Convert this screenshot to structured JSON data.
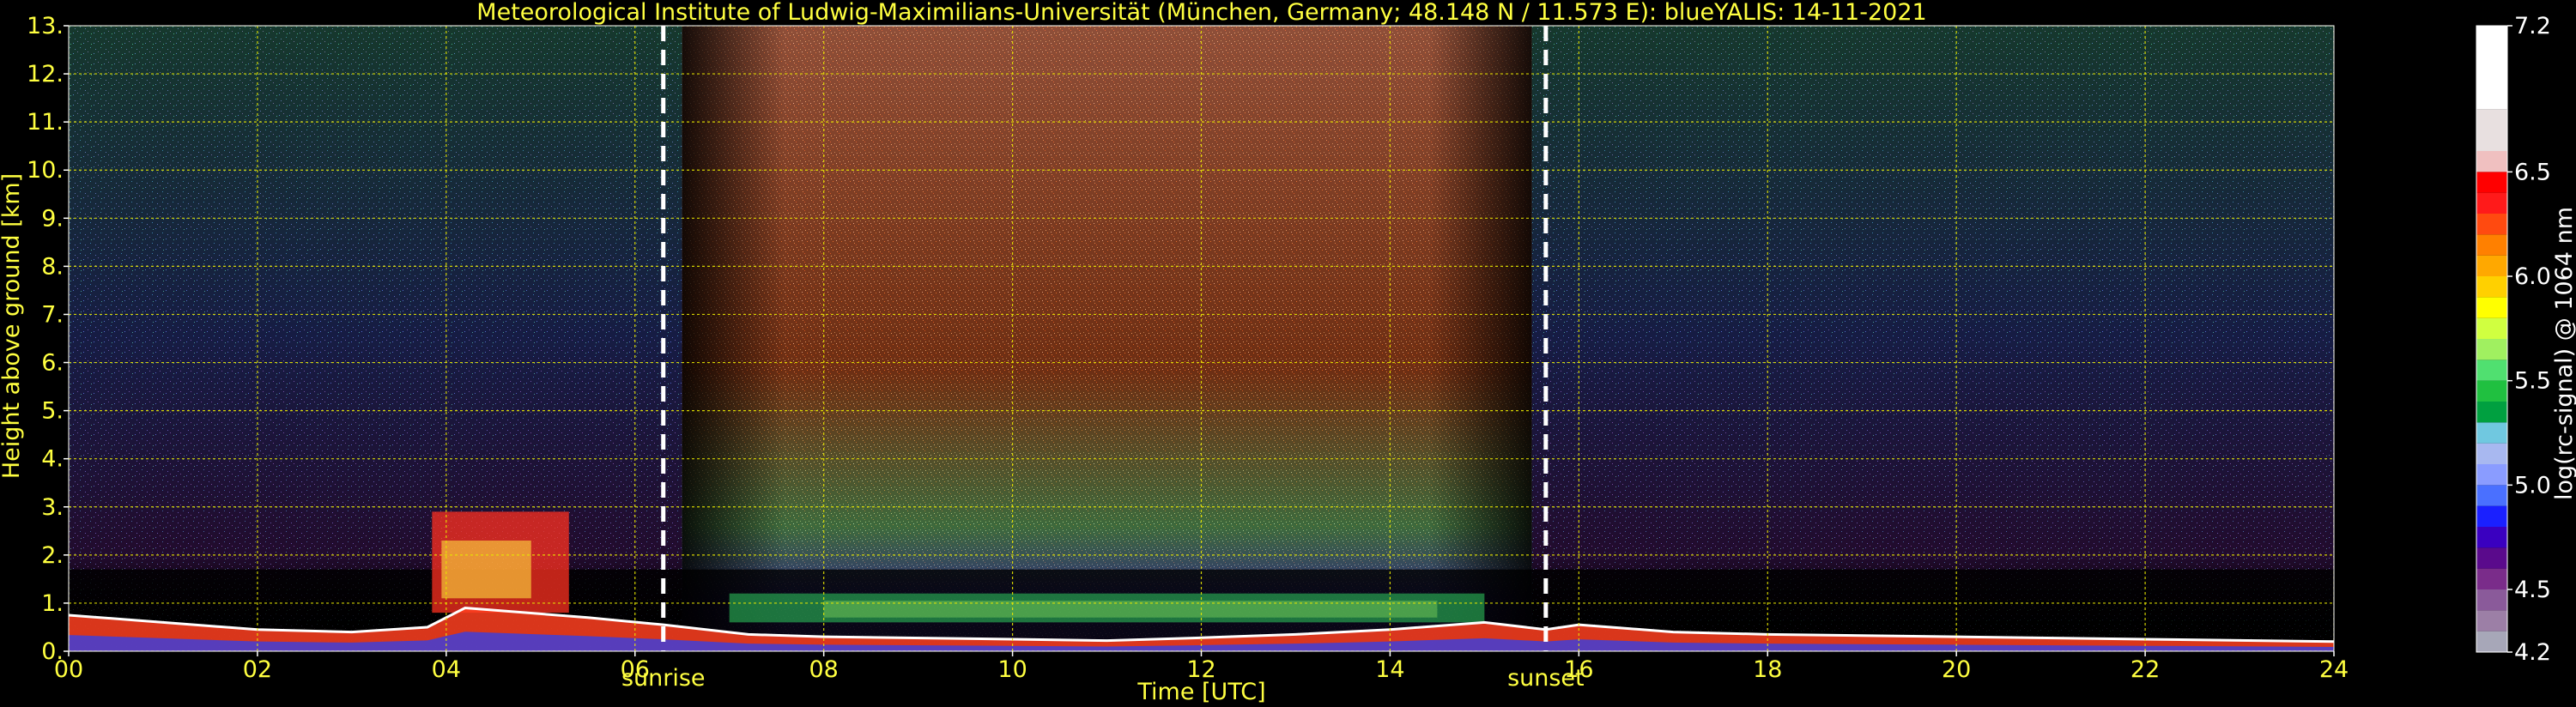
{
  "colors": {
    "background": "#000000",
    "text_yellow": "#ffff40",
    "text_white": "#ffffff",
    "grid": "#e8e800",
    "marker_line": "#ffffff"
  },
  "chart_data": {
    "type": "heatmap",
    "title": "Meteorological Institute of Ludwig-Maximilians-Universität (München, Germany; 48.148 N / 11.573 E):     blueYALIS: 14-11-2021",
    "xlabel": "Time [UTC]",
    "ylabel": "Height above ground [km]",
    "xlim": [
      0,
      24
    ],
    "ylim": [
      0,
      13
    ],
    "x_ticks": [
      0,
      2,
      4,
      6,
      8,
      10,
      12,
      14,
      16,
      18,
      20,
      22,
      24
    ],
    "x_tick_labels": [
      "00",
      "02",
      "04",
      "06",
      "08",
      "10",
      "12",
      "14",
      "16",
      "18",
      "20",
      "22",
      "24"
    ],
    "y_ticks": [
      0,
      1,
      2,
      3,
      4,
      5,
      6,
      7,
      8,
      9,
      10,
      11,
      12,
      13
    ],
    "y_tick_labels": [
      "0.",
      "1.",
      "2.",
      "3.",
      "4.",
      "5.",
      "6.",
      "7.",
      "8.",
      "9.",
      "10.",
      "11.",
      "12.",
      "13."
    ],
    "grid": true,
    "grid_style": "dashed",
    "markers": [
      {
        "label": "sunrise",
        "x": 6.3
      },
      {
        "label": "sunset",
        "x": 15.65
      }
    ],
    "colorbar": {
      "label": "log(rc-signal) @ 1064 nm",
      "range": [
        4.2,
        7.2
      ],
      "tick_values": [
        4.2,
        4.5,
        5.0,
        5.5,
        6.0,
        6.5,
        7.2
      ],
      "tick_labels": [
        "4.2",
        "4.5",
        "5.0",
        "5.5",
        "6.0",
        "6.5",
        "7.2"
      ],
      "levels": [
        {
          "from": 4.2,
          "to": 4.3,
          "color": "#a7a7b8"
        },
        {
          "from": 4.3,
          "to": 4.4,
          "color": "#9c7fa6"
        },
        {
          "from": 4.4,
          "to": 4.5,
          "color": "#8a5a9a"
        },
        {
          "from": 4.5,
          "to": 4.6,
          "color": "#7a2c8a"
        },
        {
          "from": 4.6,
          "to": 4.7,
          "color": "#5a0a8c"
        },
        {
          "from": 4.7,
          "to": 4.8,
          "color": "#3a00c0"
        },
        {
          "from": 4.8,
          "to": 4.9,
          "color": "#1a20ff"
        },
        {
          "from": 4.9,
          "to": 5.0,
          "color": "#4a70ff"
        },
        {
          "from": 5.0,
          "to": 5.1,
          "color": "#8a9cff"
        },
        {
          "from": 5.1,
          "to": 5.2,
          "color": "#a8b8f0"
        },
        {
          "from": 5.2,
          "to": 5.3,
          "color": "#70c8e0"
        },
        {
          "from": 5.3,
          "to": 5.4,
          "color": "#00a040"
        },
        {
          "from": 5.4,
          "to": 5.5,
          "color": "#20c040"
        },
        {
          "from": 5.5,
          "to": 5.6,
          "color": "#50e070"
        },
        {
          "from": 5.6,
          "to": 5.7,
          "color": "#a0f060"
        },
        {
          "from": 5.7,
          "to": 5.8,
          "color": "#d0ff40"
        },
        {
          "from": 5.8,
          "to": 5.9,
          "color": "#ffff00"
        },
        {
          "from": 5.9,
          "to": 6.0,
          "color": "#ffd000"
        },
        {
          "from": 6.0,
          "to": 6.1,
          "color": "#ffa800"
        },
        {
          "from": 6.1,
          "to": 6.2,
          "color": "#ff8000"
        },
        {
          "from": 6.2,
          "to": 6.3,
          "color": "#ff4a10"
        },
        {
          "from": 6.3,
          "to": 6.4,
          "color": "#ff1a1a"
        },
        {
          "from": 6.4,
          "to": 6.5,
          "color": "#ff0000"
        },
        {
          "from": 6.5,
          "to": 6.6,
          "color": "#f0c0c0"
        },
        {
          "from": 6.6,
          "to": 6.8,
          "color": "#e8e0e0"
        },
        {
          "from": 6.8,
          "to": 7.2,
          "color": "#ffffff"
        }
      ]
    },
    "features": [
      {
        "kind": "boundary_layer",
        "points": [
          [
            0,
            0.75
          ],
          [
            1,
            0.6
          ],
          [
            2,
            0.45
          ],
          [
            3,
            0.4
          ],
          [
            3.8,
            0.5
          ],
          [
            4.2,
            0.9
          ],
          [
            5.5,
            0.7
          ],
          [
            6.3,
            0.55
          ],
          [
            7.2,
            0.35
          ],
          [
            8,
            0.3
          ],
          [
            10,
            0.25
          ],
          [
            11,
            0.22
          ],
          [
            12,
            0.28
          ],
          [
            13,
            0.35
          ],
          [
            14,
            0.45
          ],
          [
            15,
            0.6
          ],
          [
            15.65,
            0.45
          ],
          [
            16,
            0.55
          ],
          [
            17,
            0.4
          ],
          [
            18,
            0.35
          ],
          [
            20,
            0.3
          ],
          [
            22,
            0.25
          ],
          [
            24,
            0.2
          ]
        ]
      },
      {
        "kind": "aerosol_layer",
        "x_range": [
          7.0,
          15.0
        ],
        "height_range": [
          0.6,
          1.2
        ]
      },
      {
        "kind": "low_cloud",
        "x_range": [
          3.85,
          5.3
        ],
        "height_range": [
          0.8,
          2.9
        ]
      },
      {
        "kind": "daytime_background",
        "x_range": [
          6.5,
          15.5
        ]
      }
    ]
  }
}
